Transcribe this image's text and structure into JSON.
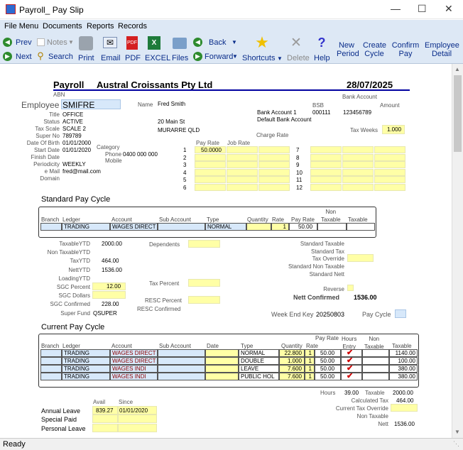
{
  "window": {
    "title": "Payroll_ Pay Slip"
  },
  "menu": [
    "File Menu",
    "Documents",
    "Reports",
    "Records"
  ],
  "toolbar": {
    "prev": "Prev",
    "notes": "Notes",
    "back": "Back",
    "next": "Next",
    "search": "Search",
    "print": "Print",
    "email": "Email",
    "pdf": "PDF",
    "excel": "EXCEL",
    "files": "Files",
    "forward": "Forward",
    "shortcuts": "Shortcuts",
    "delete": "Delete",
    "help": "Help",
    "new_period": "New\nPeriod",
    "create_cycle": "Create\nCycle",
    "confirm_pay": "Confirm\nPay",
    "employee_detail": "Employee\nDetail"
  },
  "header": {
    "payroll": "Payroll",
    "company": "Austral Croissants Pty Ltd",
    "date": "28/07/2025",
    "abn": "ABN",
    "bank_account_label": "Bank Account"
  },
  "employee": {
    "label": "Employee",
    "code": "SMIFRE",
    "name_label": "Name",
    "name": "Fred Smith",
    "address1": "20 Main St",
    "address2": "MURARRE QLD"
  },
  "details": [
    {
      "label": "Title",
      "value": "OFFICE"
    },
    {
      "label": "Status",
      "value": "ACTIVE"
    },
    {
      "label": "Tax Scale",
      "value": "SCALE 2"
    },
    {
      "label": "Super No",
      "value": "789789"
    },
    {
      "label": "Date Of Birth",
      "value": "01/01/2000"
    },
    {
      "label": "Start Date",
      "value": "01/01/2020"
    },
    {
      "label": "Finish Date",
      "value": ""
    },
    {
      "label": "Periodicity",
      "value": "WEEKLY"
    },
    {
      "label": "e Mail",
      "value": "fred@mail.com"
    },
    {
      "label": "Domain",
      "value": ""
    }
  ],
  "contact": {
    "category_label": "Category",
    "phone_label": "Phone",
    "phone": "0400 000 000",
    "mobile_label": "Mobile"
  },
  "bank": {
    "bsb_label": "BSB",
    "amount_label": "Amount",
    "account1_label": "Bank Account 1",
    "bsb": "000111",
    "account_no": "123456789",
    "default_label": "Default Bank Account",
    "charge_rate_label": "Charge Rate",
    "tax_weeks_label": "Tax Weeks",
    "tax_weeks": "1.000"
  },
  "rates": {
    "pay_rate_label": "Pay Rate",
    "job_rate_label": "Job Rate",
    "left_rows": [
      "1",
      "2",
      "3",
      "4",
      "5",
      "6"
    ],
    "right_rows": [
      "7",
      "8",
      "9",
      "10",
      "11",
      "12"
    ],
    "rate1": "50.0000"
  },
  "standard": {
    "title": "Standard Pay Cycle",
    "headers": {
      "branch": "Branch",
      "ledger": "Ledger",
      "account": "Account",
      "sub_account": "Sub Account",
      "type": "Type",
      "quantity": "Quantity",
      "rate": "Rate",
      "pay_rate": "Pay Rate",
      "non_taxable": "Non\nTaxable",
      "taxable": "Taxable"
    },
    "row": {
      "ledger": "TRADING",
      "account": "WAGES DIRECT",
      "type": "NORMAL",
      "rate": "1",
      "pay_rate": "50.00"
    }
  },
  "ytd": [
    {
      "label": "TaxableYTD",
      "value": "2000.00"
    },
    {
      "label": "Non TaxableYTD",
      "value": ""
    },
    {
      "label": "TaxYTD",
      "value": "464.00"
    },
    {
      "label": "NettYTD",
      "value": "1536.00"
    },
    {
      "label": "LoadingYTD",
      "value": ""
    },
    {
      "label": "SGC Percent",
      "value": "12.00"
    },
    {
      "label": "SGC Dollars",
      "value": ""
    },
    {
      "label": "SGC Confirmed",
      "value": "228.00"
    },
    {
      "label": "Super Fund",
      "value": "QSUPER"
    }
  ],
  "middle": {
    "dependents": "Dependents",
    "tax_percent": "Tax Percent",
    "resc_percent": "RESC Percent",
    "resc_confirmed": "RESC Confirmed"
  },
  "summary": {
    "standard_taxable": "Standard Taxable",
    "standard_tax": "Standard Tax",
    "tax_override": "Tax Override",
    "standard_non_taxable": "Standard Non Taxable",
    "standard_nett": "Standard Nett",
    "reverse": "Reverse",
    "nett_confirmed_label": "Nett Confirmed",
    "nett_confirmed": "1536.00",
    "week_end_key_label": "Week End Key",
    "week_end_key": "20250803",
    "pay_cycle_label": "Pay Cycle"
  },
  "current": {
    "title": "Current Pay Cycle",
    "headers": {
      "branch": "Branch",
      "ledger": "Ledger",
      "account": "Account",
      "sub_account": "Sub Account",
      "date": "Date",
      "type": "Type",
      "quantity": "Quantity",
      "rate": "Rate",
      "pay_rate": "Pay Rate",
      "hours_entry": "Hours\nEntry",
      "non_taxable": "Non\nTaxable",
      "taxable": "Taxable"
    },
    "rows": [
      {
        "ledger": "TRADING",
        "account": "WAGES DIRECT",
        "type": "NORMAL",
        "quantity": "22.800",
        "rate": "1",
        "pay_rate": "50.00",
        "taxable": "1140.00"
      },
      {
        "ledger": "TRADING",
        "account": "WAGES DIRECT",
        "type": "DOUBLE",
        "quantity": "1.000",
        "rate": "1",
        "pay_rate": "50.00",
        "taxable": "100.00"
      },
      {
        "ledger": "TRADING",
        "account": "WAGES INDI",
        "type": "LEAVE",
        "quantity": "7.600",
        "rate": "1",
        "pay_rate": "50.00",
        "taxable": "380.00"
      },
      {
        "ledger": "TRADING",
        "account": "WAGES INDI",
        "type": "PUBLIC HOL",
        "quantity": "7.600",
        "rate": "1",
        "pay_rate": "50.00",
        "taxable": "380.00"
      }
    ]
  },
  "totals": {
    "hours_label": "Hours",
    "hours": "39.00",
    "taxable_label": "Taxable",
    "taxable": "2000.00",
    "calc_tax_label": "Calculated Tax",
    "calc_tax": "464.00",
    "current_override_label": "Current Tax Override",
    "non_taxable_label": "Non Taxable",
    "nett_label": "Nett",
    "nett": "1536.00"
  },
  "leave": {
    "avail_label": "Avail",
    "since_label": "Since",
    "annual_label": "Annual Leave",
    "annual_avail": "839.27",
    "annual_since": "01/01/2020",
    "special_label": "Special Paid",
    "personal_label": "Personal Leave"
  },
  "status": "Ready",
  "colors": {
    "accent": "#0000a0",
    "field_yellow": "#ffffa6",
    "field_blue": "#d7e8fa",
    "tick_red": "#d00000"
  }
}
